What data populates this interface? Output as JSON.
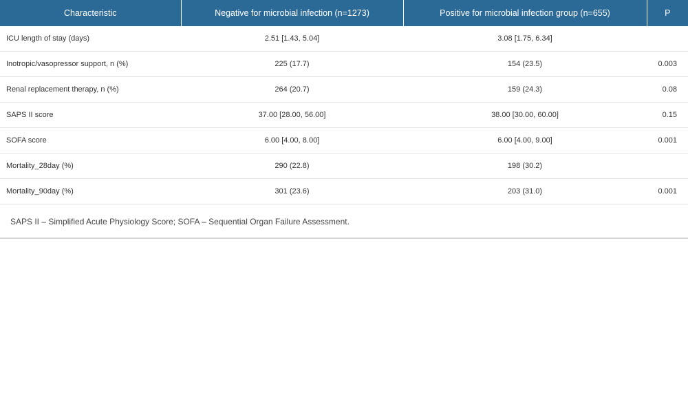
{
  "table": {
    "headers": [
      "Characteristic",
      "Negative for microbial infection (n=1273)",
      "Positive for microbial infection group (n=655)",
      "P"
    ],
    "rows": [
      {
        "characteristic": "ICU length of stay (days)",
        "negative": "2.51 [1.43, 5.04]",
        "positive": "3.08 [1.75, 6.34]",
        "p": ""
      },
      {
        "characteristic": "Inotropic/vasopressor support, n (%)",
        "negative": "225 (17.7)",
        "positive": "154 (23.5)",
        "p": "0.003"
      },
      {
        "characteristic": "Renal replacement therapy, n (%)",
        "negative": "264 (20.7)",
        "positive": "159 (24.3)",
        "p": "0.08"
      },
      {
        "characteristic": "SAPS II score",
        "negative": "37.00 [28.00, 56.00]",
        "positive": "38.00 [30.00, 60.00]",
        "p": "0.15"
      },
      {
        "characteristic": "SOFA score",
        "negative": "6.00 [4.00, 8.00]",
        "positive": "6.00 [4.00, 9.00]",
        "p": "0.001"
      },
      {
        "characteristic": "Mortality_28day (%)",
        "negative": "290 (22.8)",
        "positive": "198 (30.2)",
        "p": ""
      },
      {
        "characteristic": "Mortality_90day (%)",
        "negative": "301 (23.6)",
        "positive": "203 (31.0)",
        "p": "0.001"
      }
    ],
    "footnote": "SAPS II – Simplified Acute Physiology Score; SOFA – Sequential Organ Failure Assessment."
  },
  "colors": {
    "header_bg": "#2b6a97",
    "header_text": "#ffffff",
    "row_divider": "#e2e2e2"
  }
}
